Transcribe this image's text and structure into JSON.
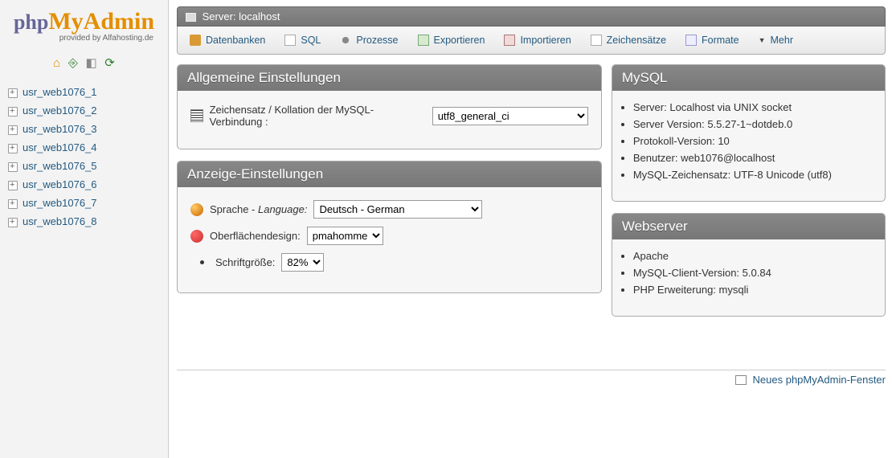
{
  "logo": {
    "p1": "php",
    "p2": "My",
    "p3": "Admin",
    "sub": "provided by Alfahosting.de"
  },
  "sidebar": {
    "dbs": [
      "usr_web1076_1",
      "usr_web1076_2",
      "usr_web1076_3",
      "usr_web1076_4",
      "usr_web1076_5",
      "usr_web1076_6",
      "usr_web1076_7",
      "usr_web1076_8"
    ]
  },
  "breadcrumb": {
    "label": "Server: localhost"
  },
  "tabs": [
    {
      "label": "Datenbanken"
    },
    {
      "label": "SQL"
    },
    {
      "label": "Prozesse"
    },
    {
      "label": "Exportieren"
    },
    {
      "label": "Importieren"
    },
    {
      "label": "Zeichensätze"
    },
    {
      "label": "Formate"
    },
    {
      "label": "Mehr"
    }
  ],
  "general": {
    "heading": "Allgemeine Einstellungen",
    "collation_label": "Zeichensatz / Kollation der MySQL-Verbindung :",
    "collation_value": "utf8_general_ci"
  },
  "display": {
    "heading": "Anzeige-Einstellungen",
    "lang_label": "Sprache - ",
    "lang_em": "Language:",
    "lang_value": "Deutsch - German",
    "theme_label": "Oberflächendesign:",
    "theme_value": "pmahomme",
    "font_label": "Schriftgröße:",
    "font_value": "82%"
  },
  "mysql": {
    "heading": "MySQL",
    "items": [
      "Server: Localhost via UNIX socket",
      "Server Version: 5.5.27-1~dotdeb.0",
      "Protokoll-Version: 10",
      "Benutzer: web1076@localhost",
      "MySQL-Zeichensatz: UTF-8 Unicode (utf8)"
    ]
  },
  "webserver": {
    "heading": "Webserver",
    "items": [
      "Apache",
      "MySQL-Client-Version: 5.0.84",
      "PHP Erweiterung: mysqli"
    ]
  },
  "footer": {
    "link": "Neues phpMyAdmin-Fenster"
  }
}
